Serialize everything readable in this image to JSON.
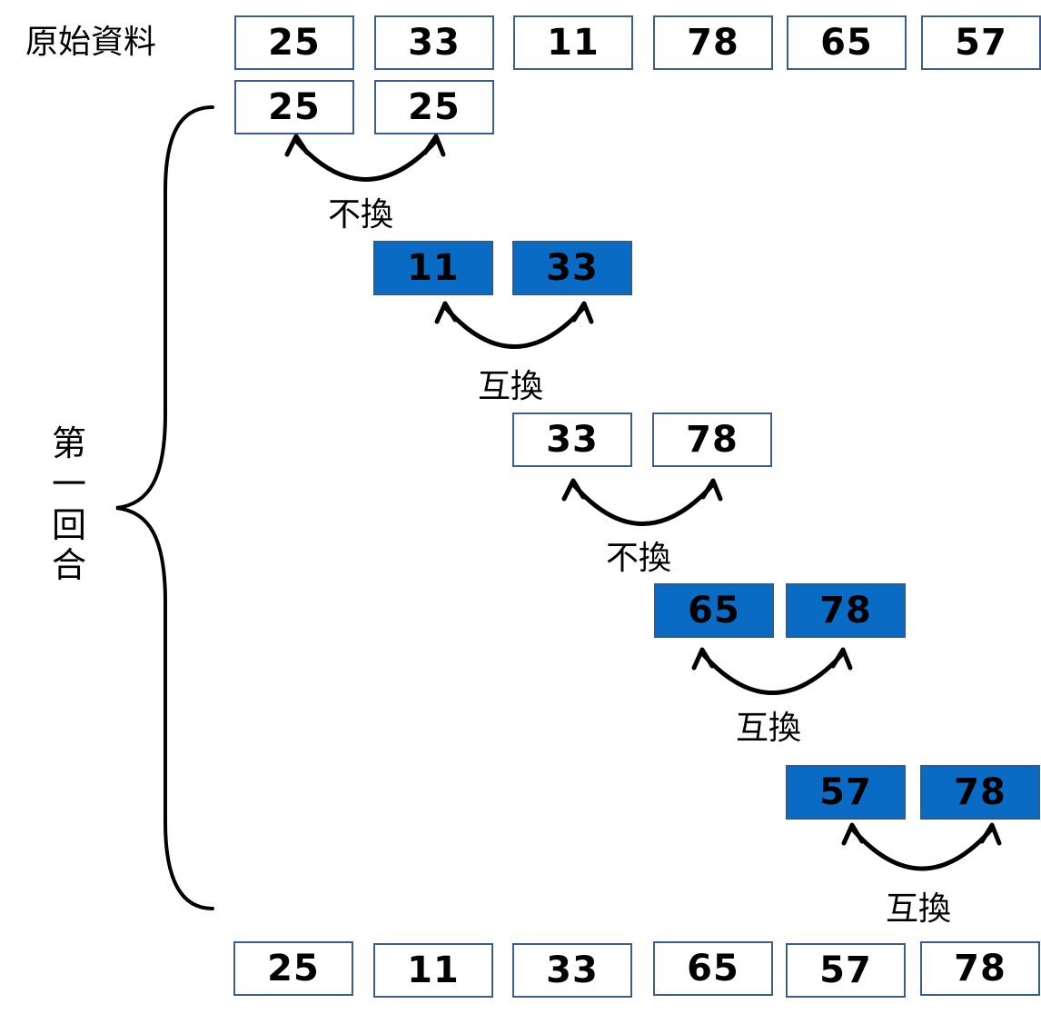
{
  "original_label": "原始資料",
  "round_label": "第一回合",
  "original_values": [
    "25",
    "33",
    "11",
    "78",
    "65",
    "57"
  ],
  "steps": [
    {
      "left": "25",
      "right": "25",
      "swapped": false,
      "action": "不換"
    },
    {
      "left": "11",
      "right": "33",
      "swapped": true,
      "action": "互換"
    },
    {
      "left": "33",
      "right": "78",
      "swapped": false,
      "action": "不換"
    },
    {
      "left": "65",
      "right": "78",
      "swapped": true,
      "action": "互換"
    },
    {
      "left": "57",
      "right": "78",
      "swapped": true,
      "action": "互換"
    }
  ],
  "result_values": [
    "25",
    "11",
    "33",
    "65",
    "57",
    "78"
  ],
  "colors": {
    "swap_fill": "#0a6bc4",
    "border": "#3a5f8f"
  }
}
